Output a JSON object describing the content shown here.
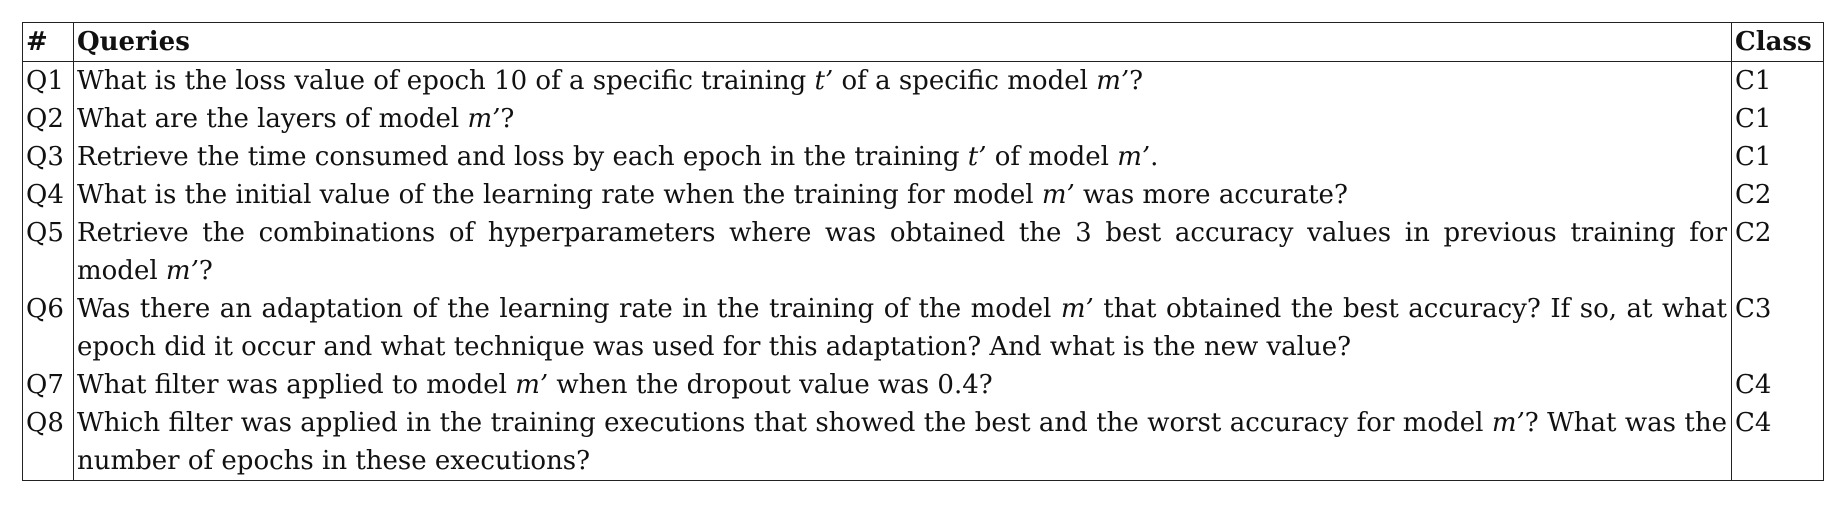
{
  "table": {
    "headers": {
      "id": "#",
      "query": "Queries",
      "class": "Class"
    },
    "rows": [
      {
        "id": "Q1",
        "query": "What is the loss value of epoch 10 of a specific training t’ of a specific model m’?",
        "class": "C1"
      },
      {
        "id": "Q2",
        "query": "What are the layers of model m’?",
        "class": "C1"
      },
      {
        "id": "Q3",
        "query": "Retrieve the time consumed and loss by each epoch in the training t’ of model m’.",
        "class": "C1"
      },
      {
        "id": "Q4",
        "query": "What is the initial value of the learning rate when the training for model m’ was more accurate?",
        "class": "C2"
      },
      {
        "id": "Q5",
        "query": "Retrieve the combinations of hyperparameters where was obtained the 3 best accuracy values in previous training for model m’?",
        "class": "C2"
      },
      {
        "id": "Q6",
        "query": "Was there an adaptation of the learning rate in the training of the model m’ that obtained the best accuracy? If so, at what epoch did it occur and what technique was used for this adaptation? And what is the new value?",
        "class": "C3"
      },
      {
        "id": "Q7",
        "query": "What filter was applied to model m’ when the dropout value was 0.4?",
        "class": "C4"
      },
      {
        "id": "Q8",
        "query": "Which filter was applied in the training executions that showed the best and the worst accuracy for model m’? What was the number of epochs in these executions?",
        "class": "C4"
      }
    ]
  }
}
